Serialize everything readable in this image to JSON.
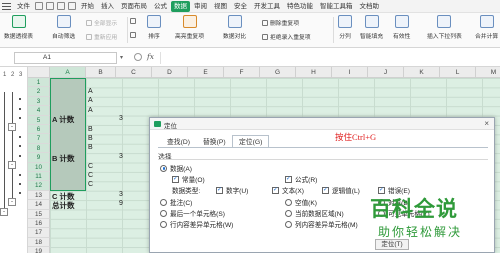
{
  "menu": {
    "file": "文件",
    "items": [
      "开始",
      "插入",
      "页面布局",
      "公式",
      "数据",
      "审阅",
      "视图",
      "安全",
      "开发工具",
      "特色功能",
      "智能工具箱",
      "文档助"
    ],
    "active_index": 4
  },
  "ribbon": {
    "pivot_table": "数据透视表",
    "auto_filter": "自动筛选",
    "show_all": "全部显示",
    "reapply": "重新应用",
    "sort": "排序",
    "highlight_dup": "高亮重复项",
    "remove_dup": "删除重复项",
    "reject_dup": "拒绝录入重复项",
    "compare": "数据对比",
    "split": "分列",
    "smart_fill": "智能填充",
    "validity": "有效性",
    "insert_dropdown": "插入下拉列表",
    "consolidate": "合并计算"
  },
  "formula_bar": {
    "name_box": "A1",
    "fx": "fx"
  },
  "outline": {
    "levels": [
      "1",
      "2",
      "3"
    ],
    "plus": "+",
    "minus": "-"
  },
  "sheet": {
    "columns": [
      "A",
      "B",
      "C",
      "D",
      "E",
      "F",
      "G",
      "H",
      "I",
      "J",
      "K",
      "L",
      "M"
    ],
    "rows": [
      "1",
      "2",
      "3",
      "4",
      "5",
      "6",
      "7",
      "8",
      "9",
      "10",
      "11",
      "12",
      "13",
      "14",
      "15",
      "16",
      "17",
      "18",
      "19"
    ],
    "selected_rows": 12,
    "cells": {
      "b2": "A",
      "b3": "A",
      "b4": "A",
      "a5": "A 计数",
      "c5": "3",
      "b6": "B",
      "b7": "B",
      "b8": "B",
      "a9": "B 计数",
      "c9": "3",
      "b10": "C",
      "b11": "C",
      "b12": "C",
      "a13": "C 计数",
      "c13": "3",
      "a14": "总计数",
      "c14": "9"
    }
  },
  "dialog": {
    "title": "定位",
    "close": "×",
    "tabs": [
      "查找(D)",
      "替换(P)",
      "定位(G)"
    ],
    "active_tab": 2,
    "hint": "按住Ctrl+G",
    "group_label": "选择",
    "data_option": "数据(A)",
    "constant": "常量(O)",
    "formula": "公式(R)",
    "data_type_label": "数据类型:",
    "number": "数字(U)",
    "text": "文本(X)",
    "logical": "逻辑值(L)",
    "error": "错误(E)",
    "comments": "批注(C)",
    "null_value": "空值(K)",
    "objects": "对象(B)",
    "last_cell": "最后一个单元格(S)",
    "current_region": "当前数据区域(N)",
    "row_diff": "行内容差异单元格(W)",
    "col_diff": "列内容差异单元格(M)",
    "visible_cells": "可见单元格(Y)",
    "locate_button": "定位(T)"
  },
  "watermark": {
    "title": "百科全说",
    "subtitle": "助你轻松解决"
  }
}
